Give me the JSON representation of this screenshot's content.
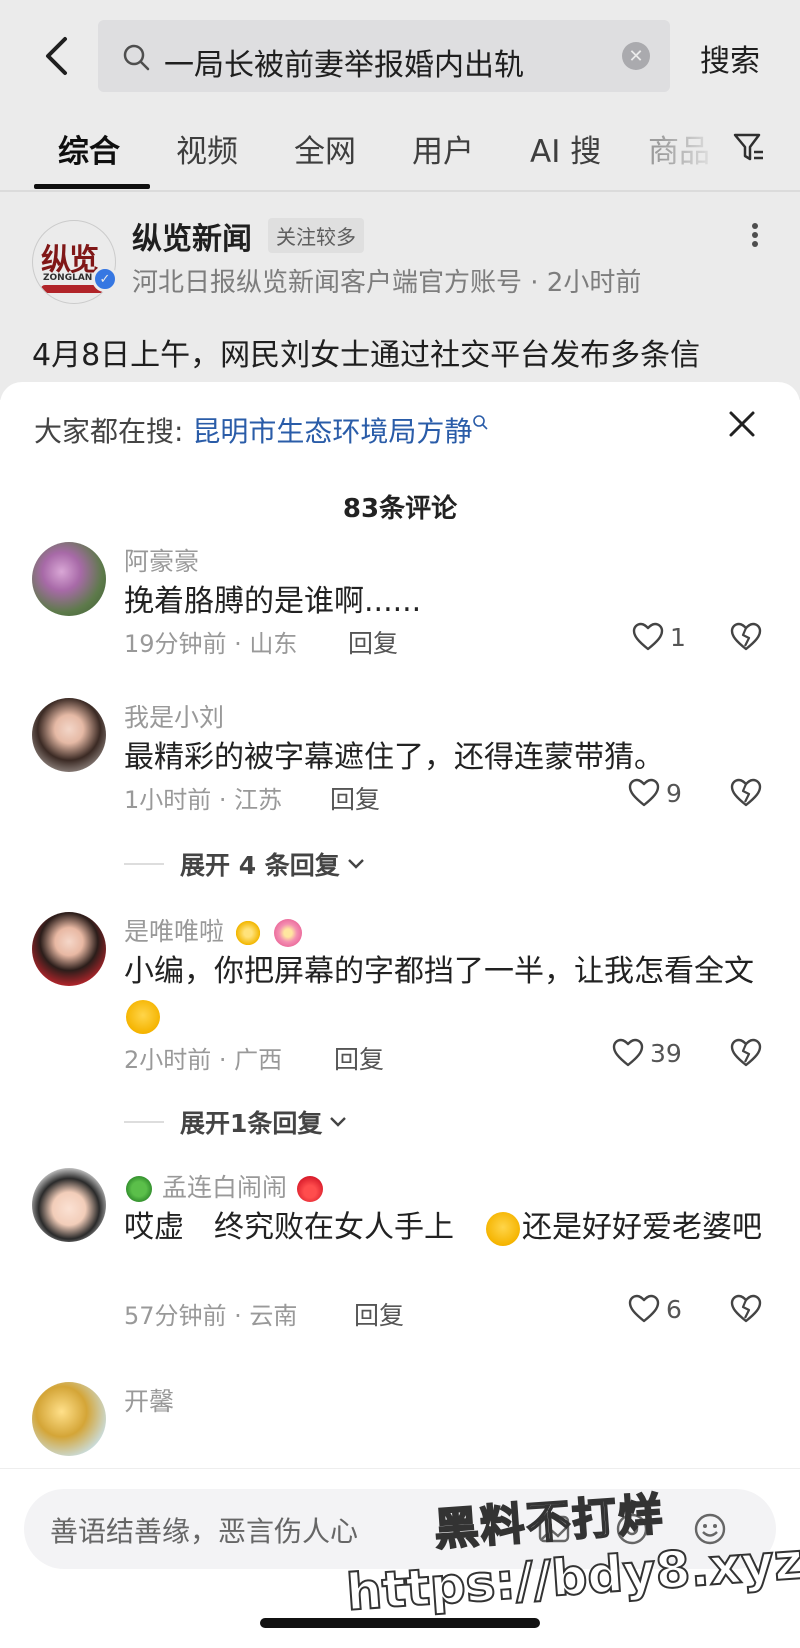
{
  "search": {
    "query": "一局长被前妻举报婚内出轨",
    "search_button": "搜索"
  },
  "tabs": [
    {
      "label": "综合"
    },
    {
      "label": "视频"
    },
    {
      "label": "全网"
    },
    {
      "label": "用户"
    },
    {
      "label": "AI 搜"
    },
    {
      "label": "商品"
    }
  ],
  "post": {
    "author": "纵览新闻",
    "author_badge": "关注较多",
    "avatar_logo_zh": "纵览",
    "avatar_logo_en": "ZONGLAN",
    "subtitle": "河北日报纵览新闻客户端官方账号 · 2小时前",
    "body": "4月8日上午，网民刘女士通过社交平台发布多条信"
  },
  "sheet": {
    "hot_search_prefix": "大家都在搜: ",
    "hot_search_link": "昆明市生态环境局方静",
    "comment_count": "83条评论"
  },
  "comments": [
    {
      "name": "阿豪豪",
      "text": "挽着胳膊的是谁啊......",
      "time": "19分钟前 · 山东",
      "reply": "回复",
      "likes": "1"
    },
    {
      "name": "我是小刘",
      "text": "最精彩的被字幕遮住了，还得连蒙带猜。",
      "time": "1小时前 · 江苏",
      "reply": "回复",
      "likes": "9",
      "expand": "展开 4 条回复"
    },
    {
      "name": "是唯唯啦",
      "text": "小编，你把屏幕的字都挡了一半，让我怎看全文",
      "time": "2小时前 · 广西",
      "reply": "回复",
      "likes": "39",
      "expand": "展开1条回复"
    },
    {
      "name": "孟连白闹闹",
      "text_a": "哎虚　终究败在女人手上　",
      "text_b": "还是好好爱老婆吧",
      "time": "57分钟前 · 云南",
      "reply": "回复",
      "likes": "6"
    },
    {
      "name": "开馨"
    }
  ],
  "input": {
    "placeholder": "善语结善缘，恶言伤人心"
  },
  "watermark": {
    "line1": "黑料不打烊",
    "line2": "https://bdy8.xyz"
  },
  "colors": {
    "link": "#2a5ca8",
    "verify": "#3b82f6",
    "brand_red": "#c0282d"
  }
}
